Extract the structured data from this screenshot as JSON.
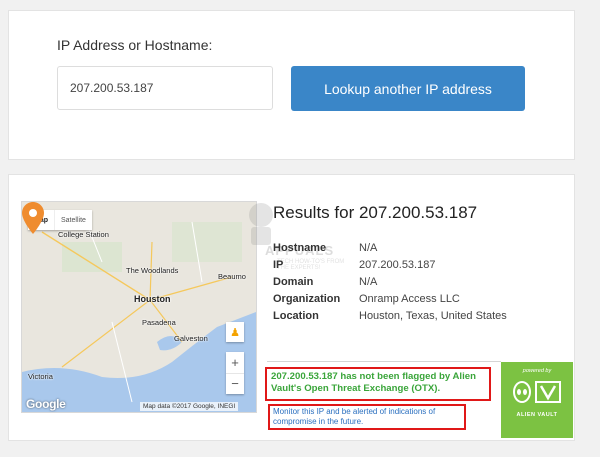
{
  "lookup": {
    "label": "IP Address or Hostname:",
    "input_value": "207.200.53.187",
    "button_label": "Lookup another IP address"
  },
  "map": {
    "toggle_map": "Map",
    "toggle_satellite": "Satellite",
    "cities": {
      "college_station": "College Station",
      "the_woodlands": "The Woodlands",
      "beaumont": "Beaumo",
      "houston": "Houston",
      "pasadena": "Pasadena",
      "galveston": "Galveston",
      "victoria": "Victoria"
    },
    "zoom_in": "+",
    "zoom_out": "−",
    "google_logo": "Google",
    "attribution": "Map data ©2017 Google, INEGI",
    "pin_icon": "location-pin-icon",
    "pegman_icon": "street-view-pegman-icon"
  },
  "results": {
    "title": "Results for 207.200.53.187",
    "rows": [
      {
        "key": "Hostname",
        "value": "N/A"
      },
      {
        "key": "IP",
        "value": "207.200.53.187"
      },
      {
        "key": "Domain",
        "value": "N/A"
      },
      {
        "key": "Organization",
        "value": "Onramp Access LLC"
      },
      {
        "key": "Location",
        "value": "Houston, Texas, United States"
      }
    ],
    "flag_text": "207.200.53.187 has not been flagged by Alien Vault's Open Threat Exchange (OTX).",
    "monitor_link": "Monitor this IP and be alerted of indications of compromise in the future."
  },
  "badge": {
    "powered_by": "powered by",
    "name": "ALIEN VAULT"
  },
  "watermark": {
    "text": "APPUALS",
    "sub": "TECH HOW-TO'S FROM THE EXPERTS!"
  },
  "colors": {
    "button": "#3a86c8",
    "flag_green": "#3aa53a",
    "link_blue": "#2a6fbf",
    "highlight_red": "#e01818",
    "badge_green": "#7cc242",
    "pin_orange": "#ef8c2f"
  }
}
